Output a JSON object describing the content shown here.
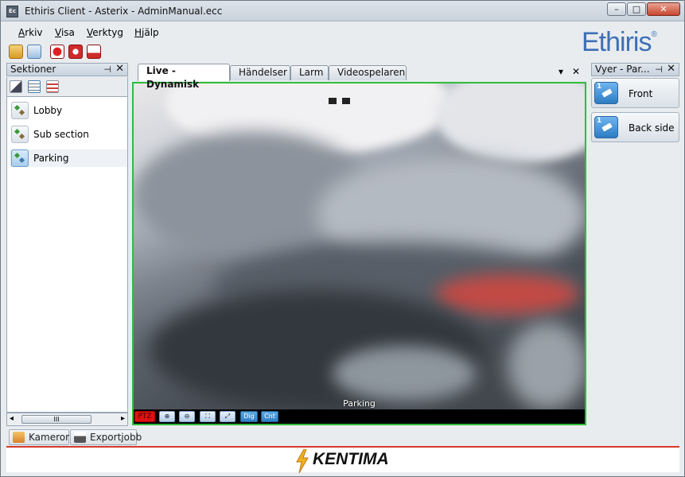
{
  "window": {
    "title": "Ethiris Client - Asterix - AdminManual.ecc",
    "app_icon": "Ec",
    "minimize": "–",
    "maximize": "□",
    "close": "✕"
  },
  "menu": [
    {
      "label": "Arkiv",
      "key": "A",
      "rest": "rkiv"
    },
    {
      "label": "Visa",
      "key": "V",
      "rest": "isa"
    },
    {
      "label": "Verktyg",
      "key": "V",
      "rest": "erktyg"
    },
    {
      "label": "Hjälp",
      "key": "H",
      "rest": "jälp"
    }
  ],
  "toolbar": {
    "icons": [
      "folder-icon",
      "refresh-icon",
      "record-icon",
      "power-icon",
      "alert-icon"
    ]
  },
  "brand": {
    "logo": "Ethiris",
    "reg": "®",
    "color": "#3d6fb4"
  },
  "sections_panel": {
    "title": "Sektioner",
    "pin": "⊣",
    "close": "✕",
    "items": [
      {
        "label": "Lobby"
      },
      {
        "label": "Sub section"
      },
      {
        "label": "Parking",
        "selected": true
      }
    ],
    "scroll_left": "◂",
    "scroll_right": "▸",
    "scroll_grip": "III"
  },
  "tabs": [
    {
      "label": "Live - Dynamisk",
      "active": true
    },
    {
      "label": "Händelser"
    },
    {
      "label": "Larm"
    },
    {
      "label": "Videospelaren"
    }
  ],
  "tab_controls": {
    "dropdown": "▾",
    "close": "✕"
  },
  "video": {
    "camera_label": "Parking",
    "border_color": "#2fbd3c",
    "controls": {
      "ptz": "PTZ",
      "zoom_in": "⊕",
      "zoom_out": "⊖",
      "fit": "⛶",
      "expand": "⤢",
      "dig": "Dig",
      "cnt": "Cnt"
    }
  },
  "views_panel": {
    "title": "Vyer - Par...",
    "pin": "⊣",
    "close": "✕",
    "items": [
      {
        "label": "Front",
        "number": "1"
      },
      {
        "label": "Back side",
        "number": "1"
      }
    ]
  },
  "bottom_tabs": [
    {
      "label": "Kameror"
    },
    {
      "label": "Exportjobb"
    }
  ],
  "footer": {
    "brand": "KENTIMA",
    "accent": "#d53a2c"
  }
}
